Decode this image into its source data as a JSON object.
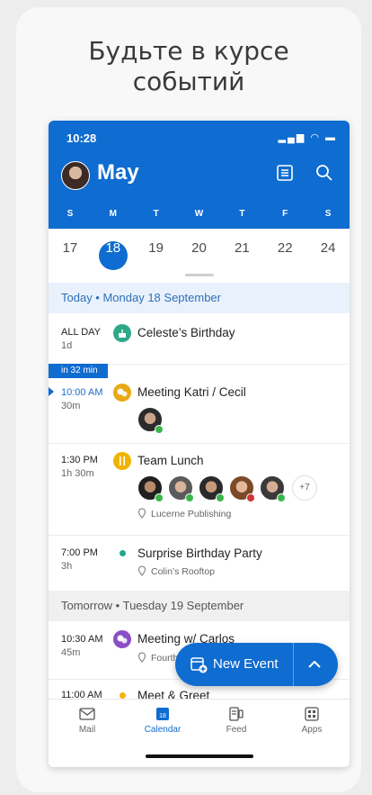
{
  "headline": {
    "line1": "Будьте в курсе",
    "line2": "событий"
  },
  "status_bar": {
    "time": "10:28",
    "icons": "▂▄▆ ◠ ▬"
  },
  "header": {
    "month": "May",
    "list_icon": "list-icon",
    "search_icon": "search-icon"
  },
  "weekdays": [
    "S",
    "M",
    "T",
    "W",
    "T",
    "F",
    "S"
  ],
  "days": [
    "17",
    "18",
    "19",
    "20",
    "21",
    "22",
    "24"
  ],
  "selected_day": "18",
  "today_header": "Today • Monday 18 September",
  "tomorrow_header": "Tomorrow • Tuesday 19 September",
  "now_indicator": "in 32 min",
  "events": [
    {
      "time": "ALL DAY",
      "duration": "1d",
      "title": "Celeste’s Birthday",
      "icon": "cake-icon",
      "color": "#2ea88a"
    },
    {
      "time": "10:00 AM",
      "duration": "30m",
      "title": "Meeting Katri / Cecil",
      "icon": "chat-icon",
      "color": "#e8a915"
    },
    {
      "time": "1:30 PM",
      "duration": "1h 30m",
      "title": "Team Lunch",
      "location": "Lucerne Publishing",
      "icon": "utensils-icon",
      "color": "#f0b400",
      "more": "+7"
    },
    {
      "time": "7:00 PM",
      "duration": "3h",
      "title": "Surprise Birthday Party",
      "location": "Colin’s Rooftop",
      "color": "#1ea891"
    },
    {
      "time": "10:30 AM",
      "duration": "45m",
      "title": "Meeting w/ Carlos",
      "location": "Fourth Coffee",
      "icon": "chat-icon",
      "color": "#8a4fc4"
    },
    {
      "time": "11:00 AM",
      "title": "Meet & Greet",
      "color": "#f0b400"
    }
  ],
  "fab": {
    "label": "New Event",
    "icon": "calendar-add-icon",
    "chevron": "⌃"
  },
  "tabs": [
    {
      "label": "Mail",
      "icon": "mail-icon"
    },
    {
      "label": "Calendar",
      "icon": "calendar-icon",
      "badge": "18",
      "active": true
    },
    {
      "label": "Feed",
      "icon": "feed-icon"
    },
    {
      "label": "Apps",
      "icon": "apps-icon"
    }
  ],
  "colors": {
    "accent": "#0f6cd0",
    "today_bg": "#e9f2fc"
  }
}
